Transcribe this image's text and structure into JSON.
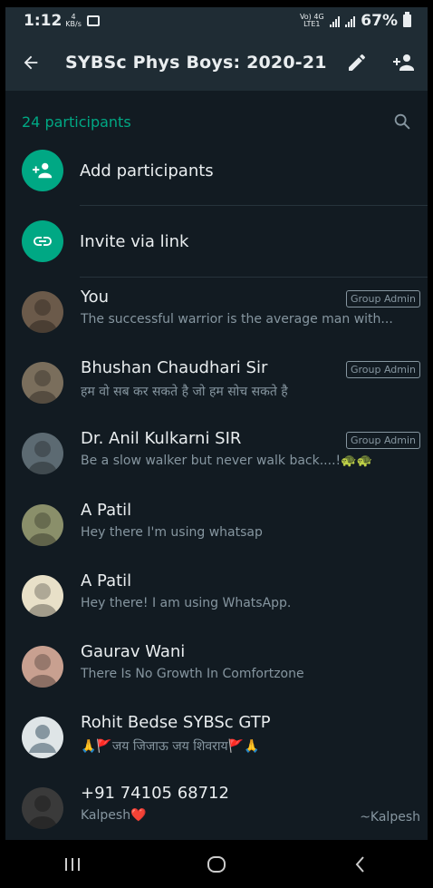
{
  "status_bar": {
    "time": "1:12",
    "speed_value": "4",
    "speed_unit": "KB/s",
    "network": "Vo) 4G LTE1",
    "battery": "67%"
  },
  "header": {
    "title": "SYBSc Phys Boys: 2020-21",
    "icons": [
      "back-arrow-icon",
      "edit-pencil-icon",
      "add-person-icon"
    ]
  },
  "participants": {
    "count_label": "24 participants",
    "add_label": "Add participants",
    "invite_label": "Invite via link"
  },
  "members": [
    {
      "name": "You",
      "status": "The successful warrior is the average man with...",
      "badge": "Group Admin",
      "avatar_color": "#6b5a4a"
    },
    {
      "name": "Bhushan Chaudhari Sir",
      "status": "हम वो सब कर सकते है जो हम सोच सकते है",
      "badge": "Group Admin",
      "avatar_color": "#7a6e5c"
    },
    {
      "name": "Dr. Anil Kulkarni SIR",
      "status": "Be a slow walker but never walk back....!🐢🐢",
      "badge": "Group Admin",
      "avatar_color": "#5c6a72"
    },
    {
      "name": "A Patil",
      "status": "Hey there I'm using whatsap",
      "badge": "",
      "avatar_color": "#8a8f6a"
    },
    {
      "name": "A Patil",
      "status": "Hey there! I am using WhatsApp.",
      "badge": "",
      "avatar_color": "#e8e0c8"
    },
    {
      "name": "Gaurav Wani",
      "status": "There Is No Growth In Comfortzone",
      "badge": "",
      "avatar_color": "#c8a090"
    },
    {
      "name": "Rohit Bedse SYBSc GTP",
      "status": "🙏🚩जय जिजाऊ जय शिवराय🚩🙏",
      "badge": "",
      "avatar_color": "#dfe5e7",
      "default_avatar": true
    },
    {
      "name": "+91 74105 68712",
      "status": "Kalpesh❤️",
      "badge": "",
      "note": "~Kalpesh",
      "avatar_color": "#3a3a3a"
    }
  ],
  "nav_bar": {
    "icons": [
      "recent-apps-icon",
      "home-icon",
      "back-icon"
    ]
  },
  "colors": {
    "background": "#121b22",
    "appbar": "#1f2c34",
    "accent": "#00a884",
    "secondary_text": "#8696a0"
  }
}
